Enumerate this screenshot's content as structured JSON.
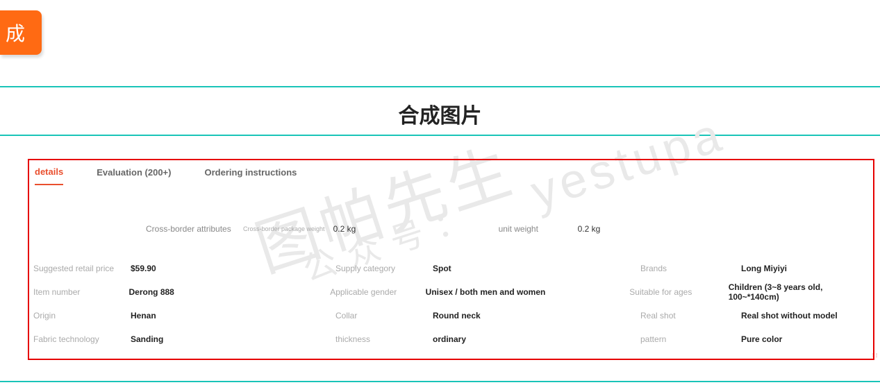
{
  "badge": "成",
  "title": "合成图片",
  "tabs": {
    "details": "details",
    "evaluation": "Evaluation (200+)",
    "ordering": "Ordering instructions"
  },
  "crossBorder": {
    "label": "Cross-border attributes",
    "pkgLabel": "Cross-border package weight",
    "pkgValue": "0.2 kg",
    "unitLabel": "unit weight",
    "unitValue": "0.2 kg"
  },
  "specs": [
    {
      "l1": "Suggested retail price",
      "v1": "$59.90",
      "l2": "Supply category",
      "v2": "Spot",
      "l3": "Brands",
      "v3": "Long Miyiyi"
    },
    {
      "l1": "Item number",
      "v1": "Derong 888",
      "l2": "Applicable gender",
      "v2": "Unisex / both men and women",
      "l3": "Suitable for ages",
      "v3": "Children (3~8 years old, 100~*140cm)"
    },
    {
      "l1": "Origin",
      "v1": "Henan",
      "l2": "Collar",
      "v2": "Round neck",
      "l3": "Real shot",
      "v3": "Real shot without model"
    },
    {
      "l1": "Fabric technology",
      "v1": "Sanding",
      "l2": "thickness",
      "v2": "ordinary",
      "l3": "pattern",
      "v3": "Pure color"
    }
  ],
  "watermark": {
    "wm1": "图帕先生",
    "wm2": "公众号：",
    "wm3": "yestupa"
  }
}
